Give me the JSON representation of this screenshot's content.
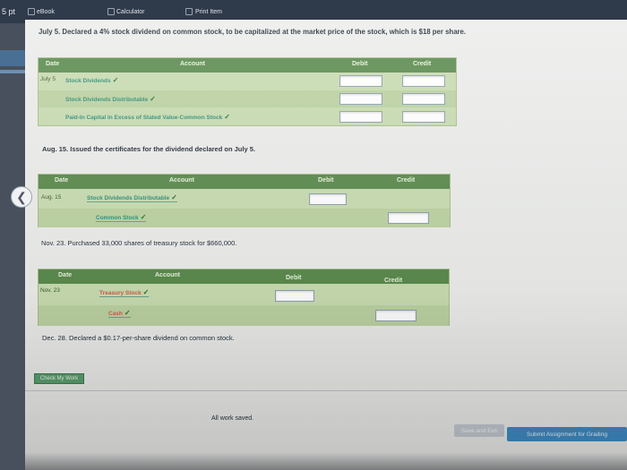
{
  "topbar": {
    "points": "5 pt",
    "tabs": [
      "eBook",
      "Calculator",
      "Print Item"
    ]
  },
  "question": {
    "july5_text": "July 5. Declared a 4% stock dividend on common stock, to be capitalized at the market price of the stock, which is $18 per share.",
    "aug15_text": "Aug. 15. Issued the certificates for the dividend declared on July 5.",
    "nov23_text": "Nov. 23. Purchased 33,000 shares of treasury stock for $660,000.",
    "dec28_text": "Dec. 28. Declared a $0.17-per-share dividend on common stock."
  },
  "headers": {
    "date": "Date",
    "account": "Account",
    "debit": "Debit",
    "credit": "Credit"
  },
  "table1": {
    "date": "July 5",
    "rows": [
      "Stock Dividends",
      "Stock Dividends Distributable",
      "Paid-In Capital in Excess of Stated Value-Common Stock"
    ]
  },
  "table2": {
    "date": "Aug. 15",
    "rows": [
      "Stock Dividends Distributable",
      "Common Stock"
    ]
  },
  "table3": {
    "date": "Nov. 23",
    "rows": [
      "Treasury Stock",
      "Cash"
    ]
  },
  "check_mark": "✓",
  "buttons": {
    "check_my_work": "Check My Work",
    "save_and_exit": "Save and Exit",
    "submit": "Submit Assignment for Grading"
  },
  "status": {
    "saved": "All work saved."
  },
  "back_icon": "chevron-left-icon"
}
